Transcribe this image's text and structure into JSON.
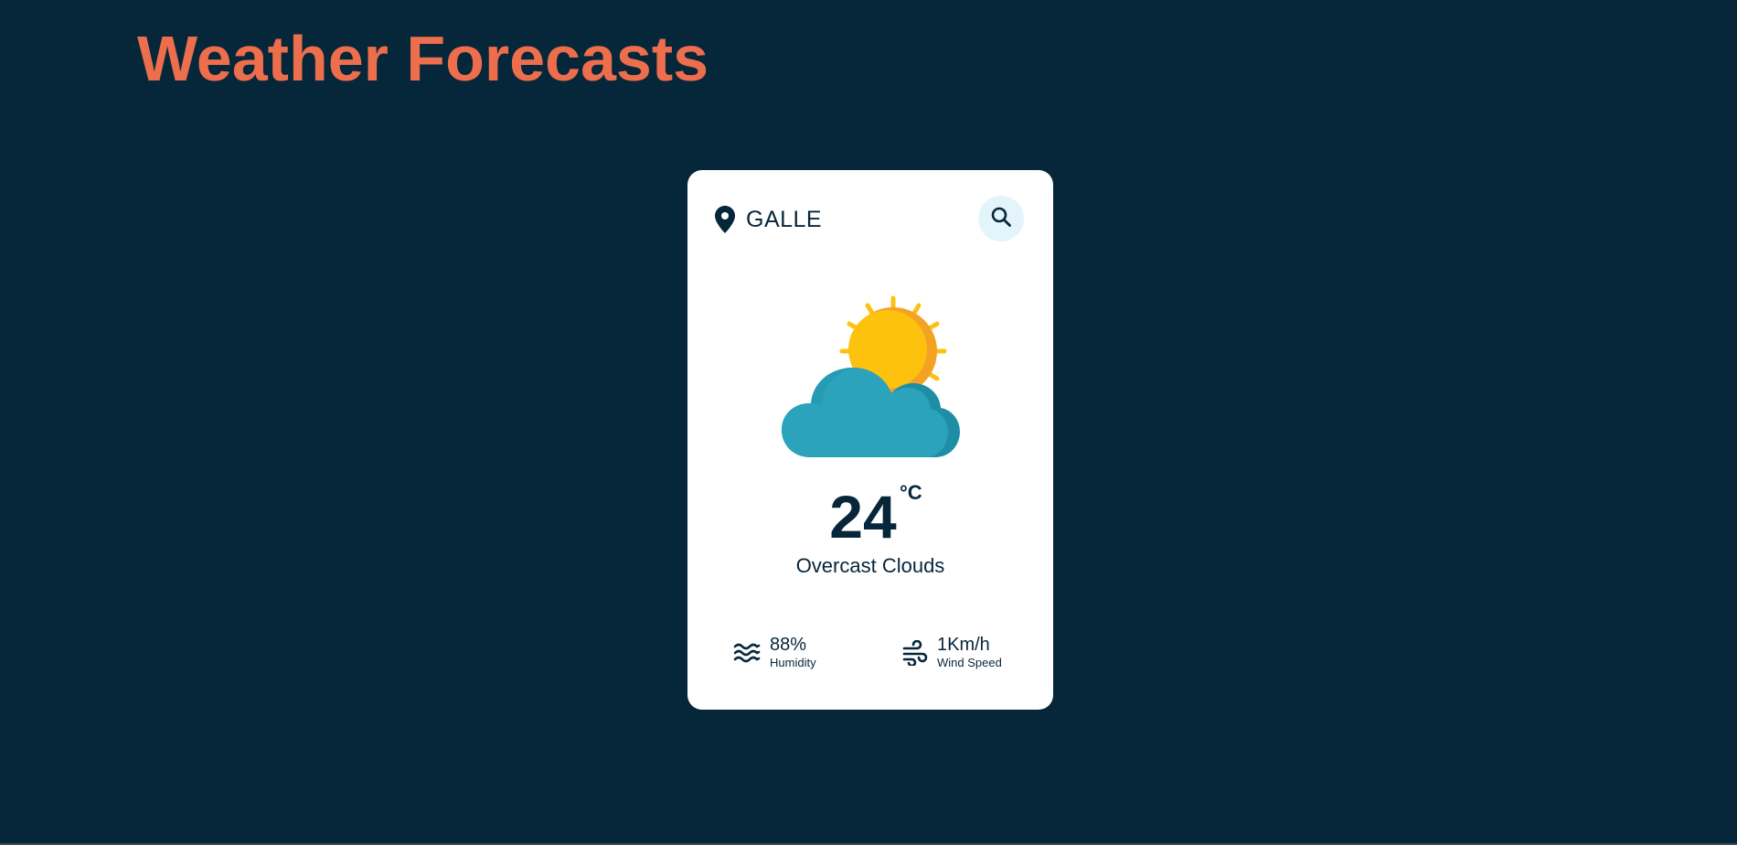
{
  "header": {
    "title": "Weather Forecasts"
  },
  "weather_card": {
    "location": "GALLE",
    "location_icon": "map-pin-icon",
    "search_icon": "search-icon",
    "condition_icon": "partly-cloudy-icon",
    "temperature": "24",
    "temperature_unit": "°C",
    "condition": "Overcast Clouds",
    "humidity": {
      "value": "88%",
      "label": "Humidity",
      "icon": "waves-icon"
    },
    "wind": {
      "value": "1Km/h",
      "label": "Wind Speed",
      "icon": "wind-icon"
    }
  },
  "colors": {
    "background": "#06263a",
    "title": "#ec6e4c",
    "card": "#ffffff",
    "text": "#06263a",
    "search_button_bg": "#e3f4fb",
    "sun": "#fcc20e",
    "sun_shade": "#f4a224",
    "cloud": "#2aa3bb",
    "cloud_shade": "#1e8ea6"
  }
}
